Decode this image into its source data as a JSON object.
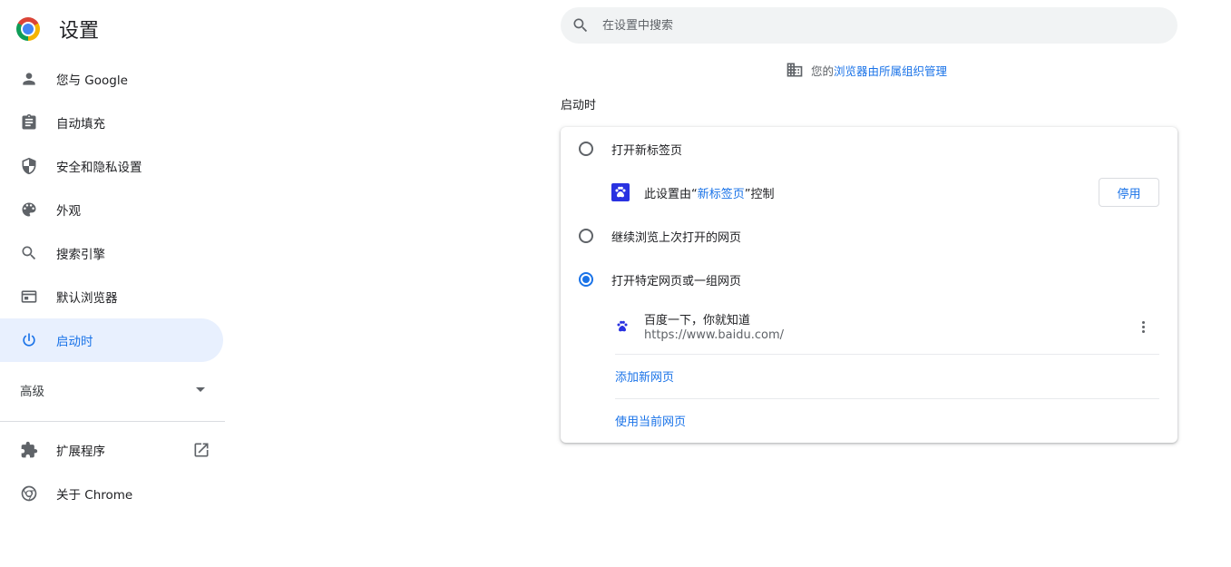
{
  "app": {
    "title": "设置",
    "logo": "chrome-logo"
  },
  "sidebar": {
    "items": [
      {
        "label": "您与 Google",
        "icon": "person-icon"
      },
      {
        "label": "自动填充",
        "icon": "clipboard-icon"
      },
      {
        "label": "安全和隐私设置",
        "icon": "shield-icon"
      },
      {
        "label": "外观",
        "icon": "palette-icon"
      },
      {
        "label": "搜索引擎",
        "icon": "search-icon"
      },
      {
        "label": "默认浏览器",
        "icon": "browser-window-icon"
      },
      {
        "label": "启动时",
        "icon": "power-icon",
        "active": true
      }
    ],
    "advanced": "高级",
    "extensions": "扩展程序",
    "about": "关于 Chrome"
  },
  "search": {
    "placeholder": "在设置中搜索"
  },
  "managed": {
    "prefix": "您的",
    "link": "浏览器由所属组织管理"
  },
  "startup": {
    "title": "启动时",
    "options": [
      {
        "label": "打开新标签页",
        "checked": false
      },
      {
        "label": "继续浏览上次打开的网页",
        "checked": false
      },
      {
        "label": "打开特定网页或一组网页",
        "checked": true
      }
    ],
    "controlled": {
      "prefix": "此设置由“",
      "ext_name": "新标签页",
      "suffix": "”控制",
      "button": "停用"
    },
    "pages": [
      {
        "title": "百度一下，你就知道",
        "url": "https://www.baidu.com/"
      }
    ],
    "add_page": "添加新网页",
    "use_current": "使用当前网页"
  },
  "colors": {
    "accent": "#1a73e8",
    "active_bg": "#e8f0fe",
    "baidu": "#2932e1"
  }
}
